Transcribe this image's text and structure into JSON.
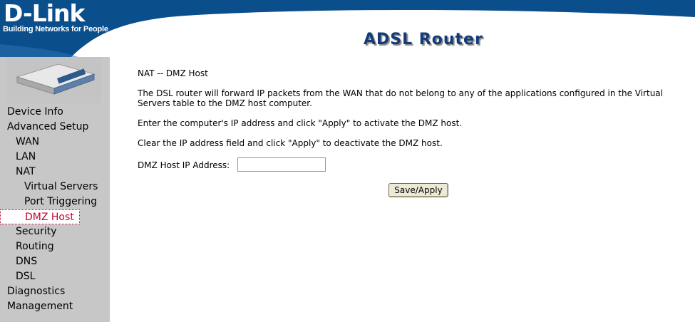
{
  "header": {
    "logo": "D-Link",
    "tagline": "Building Networks for People",
    "product_title": "ADSL Router"
  },
  "sidebar": {
    "items": [
      {
        "label": "Device Info",
        "level": 1
      },
      {
        "label": "Advanced Setup",
        "level": 1
      },
      {
        "label": "WAN",
        "level": 2
      },
      {
        "label": "LAN",
        "level": 2
      },
      {
        "label": "NAT",
        "level": 2
      },
      {
        "label": "Virtual Servers",
        "level": 3
      },
      {
        "label": "Port Triggering",
        "level": 3
      },
      {
        "label": "DMZ Host",
        "level": 3,
        "active": true
      },
      {
        "label": "Security",
        "level": 2
      },
      {
        "label": "Routing",
        "level": 2
      },
      {
        "label": "DNS",
        "level": 2
      },
      {
        "label": "DSL",
        "level": 2
      },
      {
        "label": "Diagnostics",
        "level": 1
      },
      {
        "label": "Management",
        "level": 1
      }
    ]
  },
  "main": {
    "heading": "NAT -- DMZ Host",
    "description_1": "The DSL router will forward IP packets from the WAN that do not belong to any of the applications configured in the Virtual Servers table to the DMZ host computer.",
    "description_2": "Enter the computer's IP address and click \"Apply\" to activate the DMZ host.",
    "description_3": "Clear the IP address field and click \"Apply\" to deactivate the DMZ host.",
    "dmz_label": "DMZ Host IP Address:",
    "dmz_value": "",
    "save_label": "Save/Apply"
  },
  "colors": {
    "header_blue": "#0a4e8c",
    "sidebar_bg": "#c7c7c7",
    "active_nav": "#c8002b",
    "title_color": "#133b78"
  }
}
